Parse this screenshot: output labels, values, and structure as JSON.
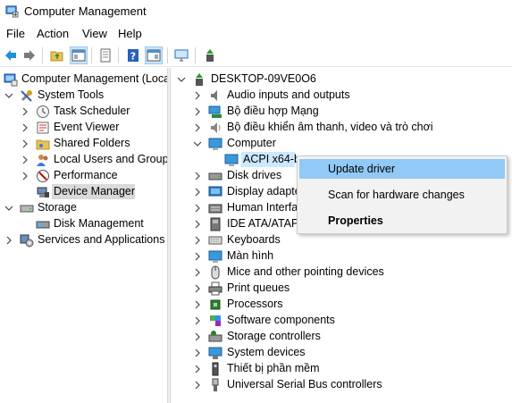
{
  "window": {
    "title": "Computer Management"
  },
  "menu": [
    "File",
    "Action",
    "View",
    "Help"
  ],
  "left_tree": {
    "root": "Computer Management (Local",
    "system_tools": "System Tools",
    "task_scheduler": "Task Scheduler",
    "event_viewer": "Event Viewer",
    "shared_folders": "Shared Folders",
    "local_users": "Local Users and Groups",
    "performance": "Performance",
    "device_manager": "Device Manager",
    "storage": "Storage",
    "disk_management": "Disk Management",
    "services_apps": "Services and Applications"
  },
  "device_tree": {
    "root": "DESKTOP-09VE0O6",
    "categories": [
      "Audio inputs and outputs",
      "Bộ điều hợp Mạng",
      "Bộ điều khiển âm thanh, video và trò chơi",
      "Computer",
      "ACPI x64-b",
      "Disk drives",
      "Display adapte",
      "Human Interfa",
      "IDE ATA/ATAPI",
      "Keyboards",
      "Màn hình",
      "Mice and other pointing devices",
      "Print queues",
      "Processors",
      "Software components",
      "Storage controllers",
      "System devices",
      "Thiết bị phần mềm",
      "Universal Serial Bus controllers"
    ]
  },
  "context_menu": {
    "update_driver": "Update driver",
    "scan": "Scan for hardware changes",
    "properties": "Properties"
  },
  "colors": {
    "selection": "#d9d9d9",
    "menu_hover": "#91c9f7",
    "accent": "#0078d7"
  }
}
